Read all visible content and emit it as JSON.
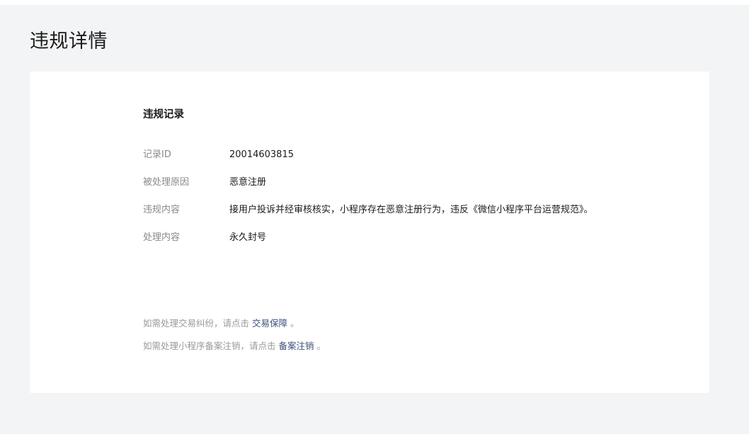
{
  "page": {
    "title": "违规详情"
  },
  "record": {
    "section_title": "违规记录",
    "rows": [
      {
        "label": "记录ID",
        "value": "20014603815"
      },
      {
        "label": "被处理原因",
        "value": "恶意注册"
      },
      {
        "label": "违规内容",
        "value": "接用户投诉并经审核核实，小程序存在恶意注册行为，违反《微信小程序平台运营规范》。"
      },
      {
        "label": "处理内容",
        "value": "永久封号"
      }
    ]
  },
  "notes": {
    "trade": {
      "prefix": "如需处理交易纠纷，请点击",
      "link": "交易保障",
      "suffix": "。"
    },
    "filing": {
      "prefix": "如需处理小程序备案注销，请点击",
      "link": "备案注销",
      "suffix": "。"
    }
  }
}
